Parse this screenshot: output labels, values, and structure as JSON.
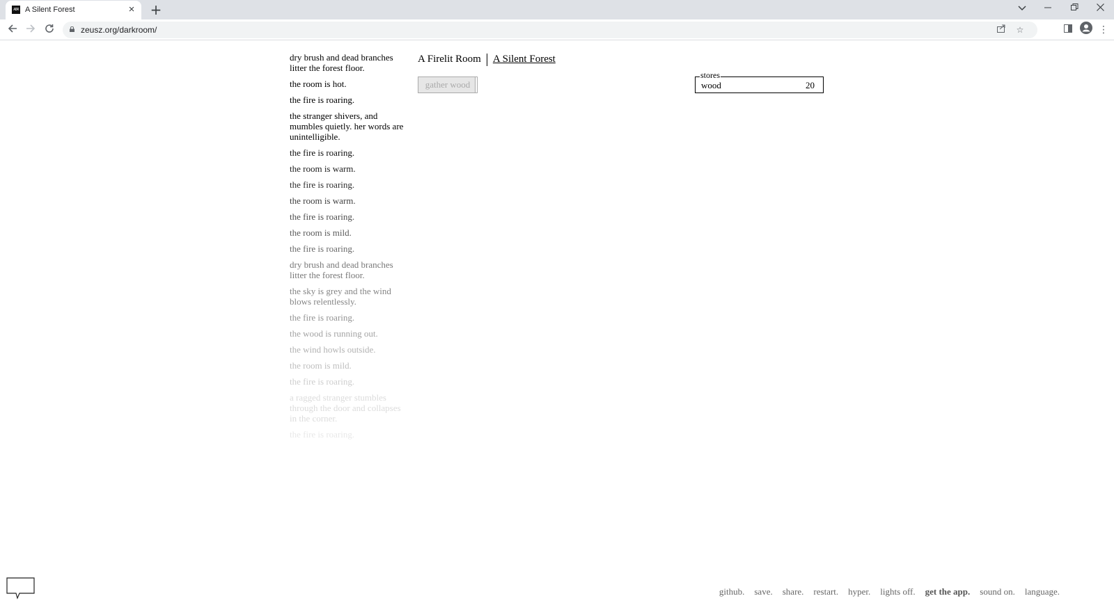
{
  "browser": {
    "tab_title": "A Silent Forest",
    "favicon_text": "ADR",
    "url": "zeusz.org/darkroom/"
  },
  "notifications": [
    "dry brush and dead branches litter the forest floor.",
    "the room is hot.",
    "the fire is roaring.",
    "the stranger shivers, and mumbles quietly. her words are unintelligible.",
    "the fire is roaring.",
    "the room is warm.",
    "the fire is roaring.",
    "the room is warm.",
    "the fire is roaring.",
    "the room is mild.",
    "the fire is roaring.",
    "dry brush and dead branches litter the forest floor.",
    "the sky is grey and the wind blows relentlessly.",
    "the fire is roaring.",
    "the wood is running out.",
    "the wind howls outside.",
    "the room is mild.",
    "the fire is roaring.",
    "a ragged stranger stumbles through the door and collapses in the corner.",
    "the fire is roaring."
  ],
  "header": {
    "room_tab": "A Firelit Room",
    "forest_tab": "A Silent Forest"
  },
  "actions": {
    "gather_wood": "gather wood"
  },
  "stores": {
    "legend": "stores",
    "items": [
      {
        "name": "wood",
        "value": "20"
      }
    ]
  },
  "footer": {
    "links": [
      "github.",
      "save.",
      "share.",
      "restart.",
      "hyper.",
      "lights off.",
      "get the app.",
      "sound on.",
      "language."
    ]
  },
  "colors": {
    "text": "#000000",
    "footer": "#666666",
    "disabled_button_bg": "#e6e6e6",
    "disabled_button_text": "#aaaaaa"
  }
}
